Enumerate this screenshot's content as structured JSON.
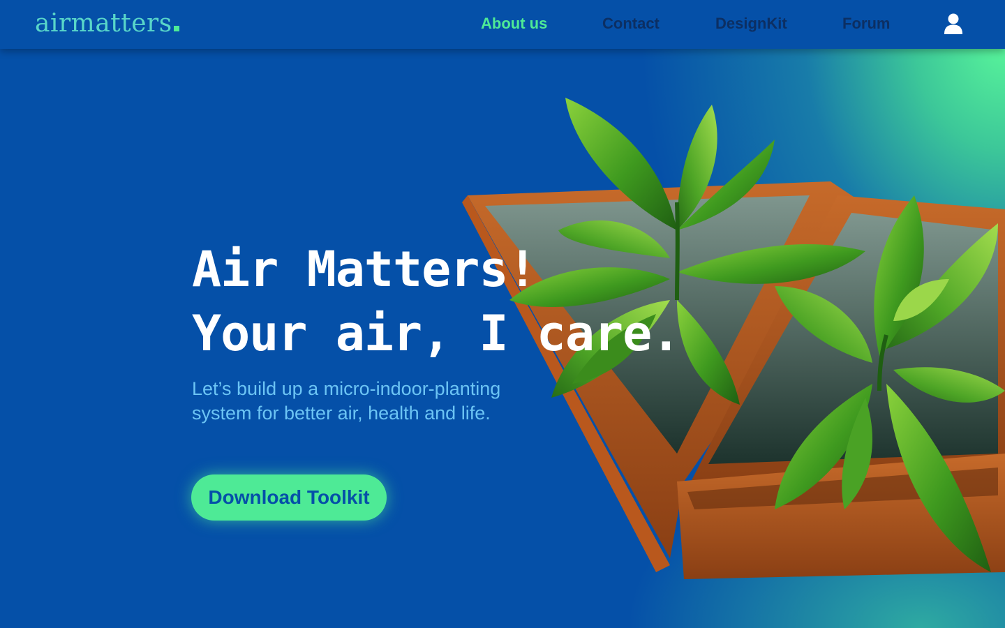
{
  "brand": {
    "logo_text": "airmatters",
    "accent": "#4eea96",
    "primary": "#0550a8"
  },
  "nav": {
    "items": [
      {
        "label": "About us",
        "active": true
      },
      {
        "label": "Contact",
        "active": false
      },
      {
        "label": "DesignKit",
        "active": false
      },
      {
        "label": "Forum",
        "active": false
      }
    ],
    "user_icon": "user-icon"
  },
  "hero": {
    "title_line1": "Air Matters!",
    "title_line2": "Your air, I care.",
    "subtitle_line1": "Let’s build up a micro-indoor-planting",
    "subtitle_line2": "system for better air, health and life.",
    "cta_label": "Download Toolkit",
    "image": "plant-planter-illustration"
  }
}
